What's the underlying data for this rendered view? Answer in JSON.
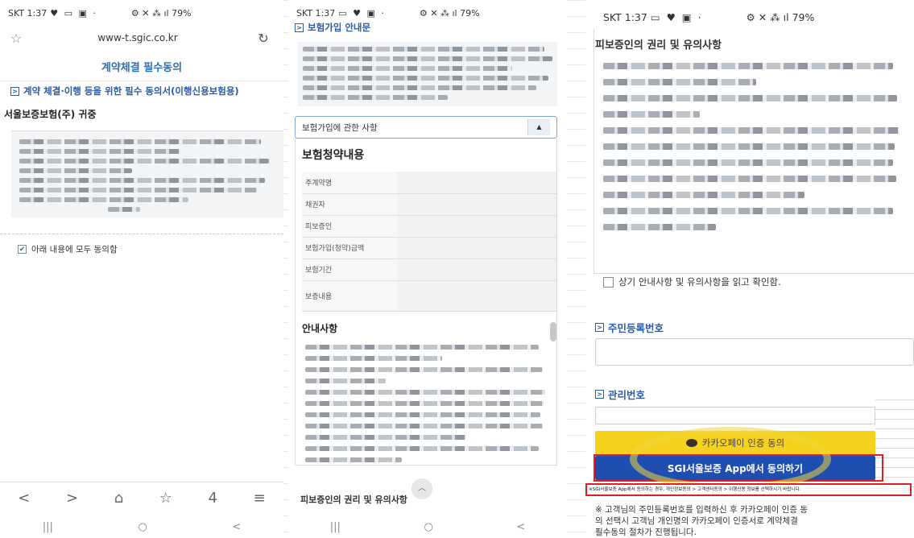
{
  "phone1": {
    "status": "SKT 1:37",
    "status_right": "79%",
    "url": "www-t.sgic.co.kr",
    "title": "계약체결 필수동의",
    "section": "계약 체결·이행 등을 위한 필수 동의서(이행신용보험용)",
    "company": "서울보증보험(주) 귀중",
    "agree_all": "아래 내용에 모두 동의함",
    "toolbar": [
      "<",
      ">",
      "⌂",
      "☆",
      "4",
      "≡"
    ],
    "nav": [
      "|||",
      "○",
      "<"
    ]
  },
  "phone2": {
    "status": "SKT 1:37",
    "status_right": "79%",
    "section": "보험가입 안내문",
    "dropdown_label": "보험가입에 관한 사항",
    "contract_title": "보험청약내용",
    "rows": [
      "주계약명",
      "채권자",
      "피보증인",
      "보험가입(청약)금액",
      "보험기간",
      "보증내용"
    ],
    "notice_title": "안내사항",
    "bottom_section": "피보증인의 권리 및 유의사항",
    "nav": [
      "|||",
      "○",
      "<"
    ]
  },
  "phone3": {
    "status": "SKT 1:37",
    "status_right": "79%",
    "title": "피보증인의 권리 및 유의사항",
    "confirm_label": "상기 안내사항 및 유의사항을 읽고 확인함.",
    "id_section": "주민등록번호",
    "mgmt_section": "관리번호",
    "kakao_label": "카카오페이 인증 동의",
    "sgi_label": "SGI서울보증 App에서 동의하기",
    "disclaimer": "※SGI서울보증 App에서 동의하는 경우, 개인정보동의 > 고객센터동의 > 이행신용 정보를 선택하시기 바랍니다.",
    "note_lines": [
      "※ 고객님의 주민등록번호를 입력하신 후 카카오페이 인증 동",
      "의 선택시 고객님 개인명의 카카오페이 인증서로 계약체결",
      "필수동의 절차가 진행됩니다."
    ]
  },
  "colors": {
    "accent_blue": "#2c6fb7",
    "kakao_yellow": "#f5d21e",
    "sgi_blue": "#1f4eb0",
    "highlight_red": "#e02020"
  }
}
